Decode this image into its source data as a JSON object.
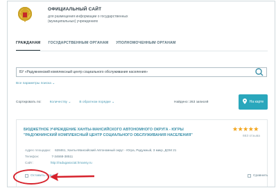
{
  "header": {
    "site_title": "ОФИЦИАЛЬНЫЙ САЙТ",
    "site_subtitle_line1": "для размещения информации о государственных",
    "site_subtitle_line2": "(муниципальных) учреждениях"
  },
  "nav": {
    "tabs": [
      {
        "label": "ГРАЖДАНАМ",
        "active": true
      },
      {
        "label": "ГОСУДАРСТВЕННЫМ ОРГАНАМ",
        "active": false
      },
      {
        "label": "УПОЛНОМОЧЕННЫМ ОРГАНАМ",
        "active": false
      }
    ]
  },
  "search": {
    "value": "БУ «Радужнинский комплексный центр социального обслуживания населения»",
    "all_params_link": "Все параметры поиска ⌄"
  },
  "sort": {
    "label": "Сортировать по:",
    "field": "Количеству ⌄",
    "order": "В обратном порядке ⌄",
    "found_text": "Найдено: 263 записей"
  },
  "map_button": {
    "label": "На карте"
  },
  "result": {
    "title_line1": "БЮДЖЕТНОЕ УЧРЕЖДЕНИЕ ХАНТЫ-МАНСИЙСКОГО АВТОНОМНОГО ОКРУГА - ЮГРЫ",
    "title_line2": "\"РАДУЖНИНСКИЙ КОМПЛЕКСНЫЙ ЦЕНТР СОЦИАЛЬНОГО ОБСЛУЖИВАНИЯ НАСЕЛЕНИЯ\"",
    "rating_stars": "★★★★★",
    "reviews": "663 отзыва",
    "address_label": "Адрес площадки:",
    "address_value": "628461, Ханты-Мансийский Автономный округ - Югра, Радужный, 3 микр, ДОМ 21",
    "phone_label": "Телефон:",
    "phone_value": "7-34668-38511",
    "site_label": "Сайт:",
    "site_value": "http://radugasocial.hmansy.ru",
    "leave_review": "Оставить отзыв",
    "compare": "Сравнить"
  },
  "colors": {
    "accent": "#2aa7bc",
    "link": "#4b9ab4",
    "star": "#f2a41a",
    "highlight": "#d6212b"
  }
}
